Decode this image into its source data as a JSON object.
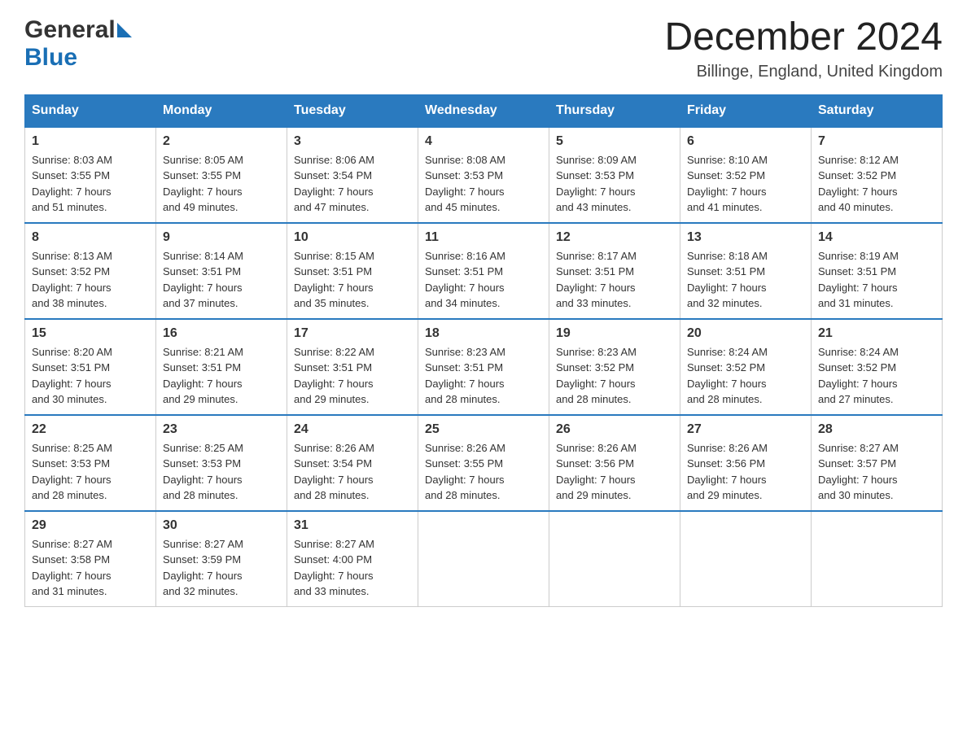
{
  "header": {
    "logo_general": "General",
    "logo_blue": "Blue",
    "title": "December 2024",
    "location": "Billinge, England, United Kingdom"
  },
  "days_of_week": [
    "Sunday",
    "Monday",
    "Tuesday",
    "Wednesday",
    "Thursday",
    "Friday",
    "Saturday"
  ],
  "weeks": [
    [
      {
        "day": "1",
        "sunrise": "8:03 AM",
        "sunset": "3:55 PM",
        "daylight": "7 hours and 51 minutes."
      },
      {
        "day": "2",
        "sunrise": "8:05 AM",
        "sunset": "3:55 PM",
        "daylight": "7 hours and 49 minutes."
      },
      {
        "day": "3",
        "sunrise": "8:06 AM",
        "sunset": "3:54 PM",
        "daylight": "7 hours and 47 minutes."
      },
      {
        "day": "4",
        "sunrise": "8:08 AM",
        "sunset": "3:53 PM",
        "daylight": "7 hours and 45 minutes."
      },
      {
        "day": "5",
        "sunrise": "8:09 AM",
        "sunset": "3:53 PM",
        "daylight": "7 hours and 43 minutes."
      },
      {
        "day": "6",
        "sunrise": "8:10 AM",
        "sunset": "3:52 PM",
        "daylight": "7 hours and 41 minutes."
      },
      {
        "day": "7",
        "sunrise": "8:12 AM",
        "sunset": "3:52 PM",
        "daylight": "7 hours and 40 minutes."
      }
    ],
    [
      {
        "day": "8",
        "sunrise": "8:13 AM",
        "sunset": "3:52 PM",
        "daylight": "7 hours and 38 minutes."
      },
      {
        "day": "9",
        "sunrise": "8:14 AM",
        "sunset": "3:51 PM",
        "daylight": "7 hours and 37 minutes."
      },
      {
        "day": "10",
        "sunrise": "8:15 AM",
        "sunset": "3:51 PM",
        "daylight": "7 hours and 35 minutes."
      },
      {
        "day": "11",
        "sunrise": "8:16 AM",
        "sunset": "3:51 PM",
        "daylight": "7 hours and 34 minutes."
      },
      {
        "day": "12",
        "sunrise": "8:17 AM",
        "sunset": "3:51 PM",
        "daylight": "7 hours and 33 minutes."
      },
      {
        "day": "13",
        "sunrise": "8:18 AM",
        "sunset": "3:51 PM",
        "daylight": "7 hours and 32 minutes."
      },
      {
        "day": "14",
        "sunrise": "8:19 AM",
        "sunset": "3:51 PM",
        "daylight": "7 hours and 31 minutes."
      }
    ],
    [
      {
        "day": "15",
        "sunrise": "8:20 AM",
        "sunset": "3:51 PM",
        "daylight": "7 hours and 30 minutes."
      },
      {
        "day": "16",
        "sunrise": "8:21 AM",
        "sunset": "3:51 PM",
        "daylight": "7 hours and 29 minutes."
      },
      {
        "day": "17",
        "sunrise": "8:22 AM",
        "sunset": "3:51 PM",
        "daylight": "7 hours and 29 minutes."
      },
      {
        "day": "18",
        "sunrise": "8:23 AM",
        "sunset": "3:51 PM",
        "daylight": "7 hours and 28 minutes."
      },
      {
        "day": "19",
        "sunrise": "8:23 AM",
        "sunset": "3:52 PM",
        "daylight": "7 hours and 28 minutes."
      },
      {
        "day": "20",
        "sunrise": "8:24 AM",
        "sunset": "3:52 PM",
        "daylight": "7 hours and 28 minutes."
      },
      {
        "day": "21",
        "sunrise": "8:24 AM",
        "sunset": "3:52 PM",
        "daylight": "7 hours and 27 minutes."
      }
    ],
    [
      {
        "day": "22",
        "sunrise": "8:25 AM",
        "sunset": "3:53 PM",
        "daylight": "7 hours and 28 minutes."
      },
      {
        "day": "23",
        "sunrise": "8:25 AM",
        "sunset": "3:53 PM",
        "daylight": "7 hours and 28 minutes."
      },
      {
        "day": "24",
        "sunrise": "8:26 AM",
        "sunset": "3:54 PM",
        "daylight": "7 hours and 28 minutes."
      },
      {
        "day": "25",
        "sunrise": "8:26 AM",
        "sunset": "3:55 PM",
        "daylight": "7 hours and 28 minutes."
      },
      {
        "day": "26",
        "sunrise": "8:26 AM",
        "sunset": "3:56 PM",
        "daylight": "7 hours and 29 minutes."
      },
      {
        "day": "27",
        "sunrise": "8:26 AM",
        "sunset": "3:56 PM",
        "daylight": "7 hours and 29 minutes."
      },
      {
        "day": "28",
        "sunrise": "8:27 AM",
        "sunset": "3:57 PM",
        "daylight": "7 hours and 30 minutes."
      }
    ],
    [
      {
        "day": "29",
        "sunrise": "8:27 AM",
        "sunset": "3:58 PM",
        "daylight": "7 hours and 31 minutes."
      },
      {
        "day": "30",
        "sunrise": "8:27 AM",
        "sunset": "3:59 PM",
        "daylight": "7 hours and 32 minutes."
      },
      {
        "day": "31",
        "sunrise": "8:27 AM",
        "sunset": "4:00 PM",
        "daylight": "7 hours and 33 minutes."
      },
      null,
      null,
      null,
      null
    ]
  ]
}
